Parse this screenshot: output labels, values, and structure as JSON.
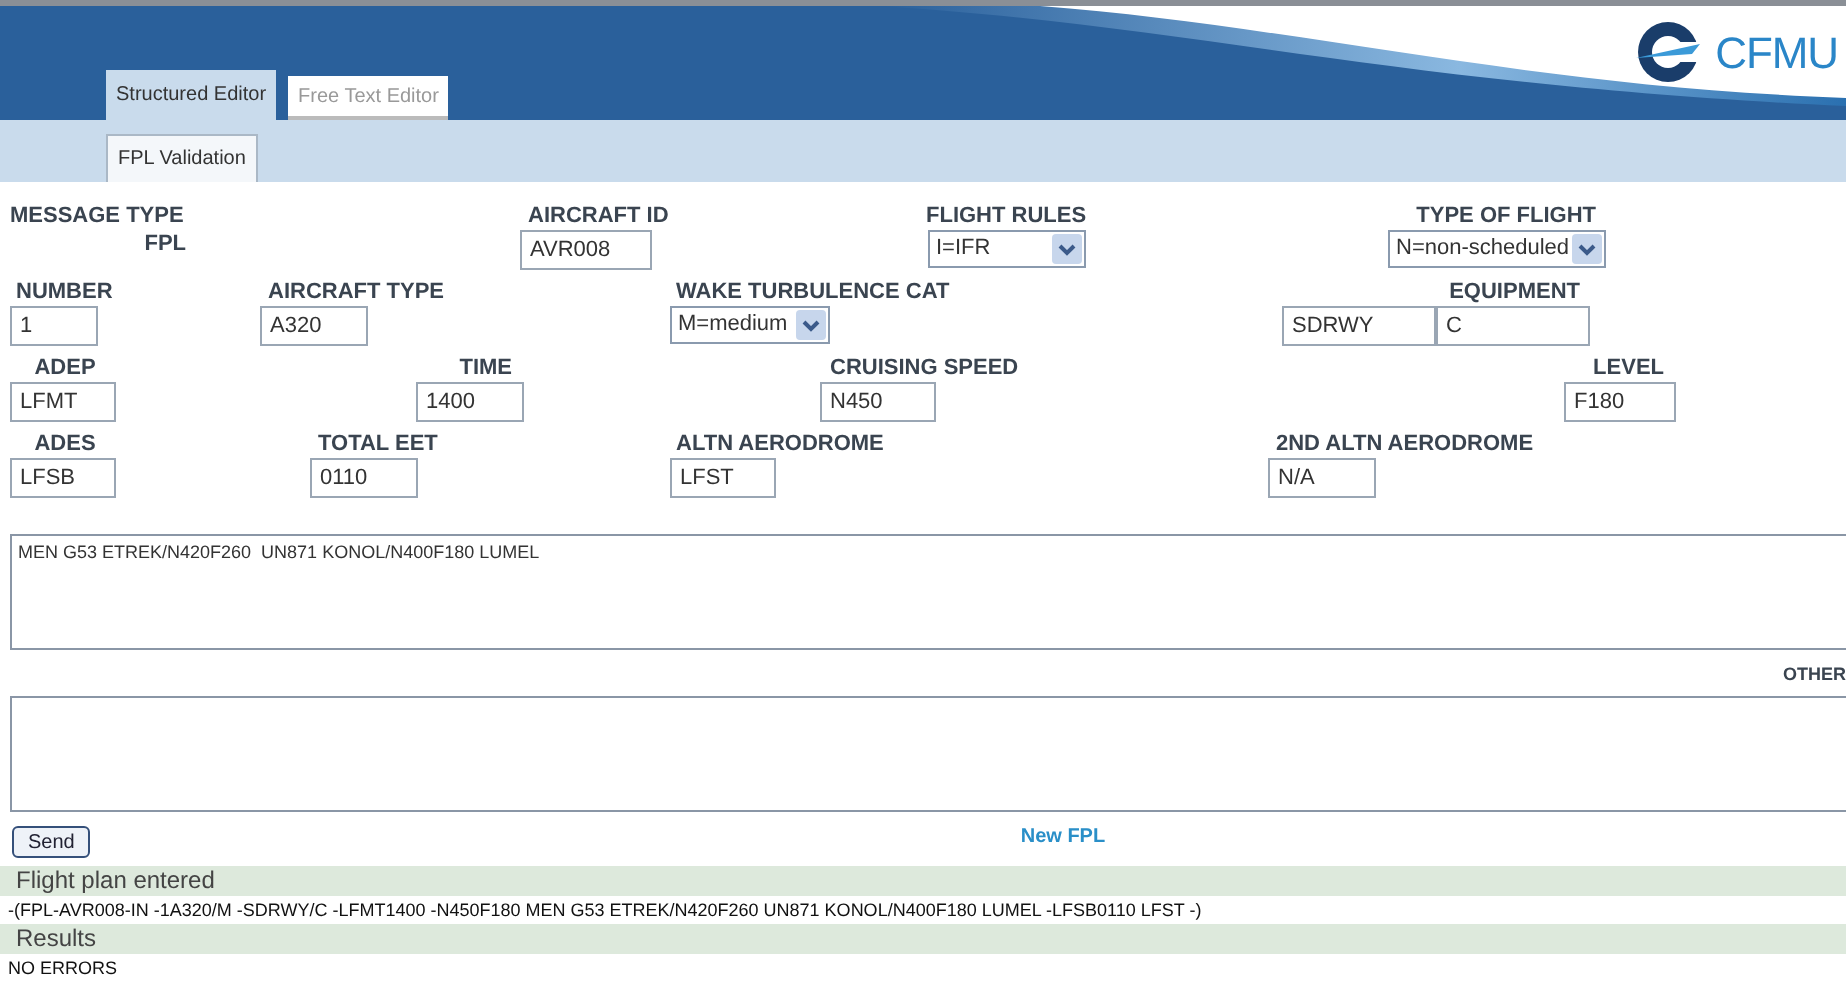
{
  "header": {
    "logo_text": "CFMU"
  },
  "tabs": [
    {
      "label": "Structured Editor",
      "selected": true
    },
    {
      "label": "Free Text Editor",
      "selected": false
    }
  ],
  "subtabs": [
    {
      "label": "FPL Validation",
      "selected": true
    }
  ],
  "form": {
    "rows": [
      [
        {
          "kind": "static",
          "label": "MESSAGE TYPE",
          "value": "FPL"
        },
        {
          "kind": "field",
          "label": "AIRCRAFT ID",
          "value": "AVR008"
        },
        {
          "kind": "select",
          "label": "FLIGHT RULES",
          "value": "I=IFR"
        },
        {
          "kind": "select",
          "label": "TYPE OF FLIGHT",
          "value": "N=non-scheduled"
        }
      ],
      [
        {
          "kind": "field",
          "label": "NUMBER",
          "value": "1"
        },
        {
          "kind": "field",
          "label": "AIRCRAFT TYPE",
          "value": "A320"
        },
        {
          "kind": "select",
          "label": "WAKE TURBULENCE CAT",
          "value": "M=medium"
        },
        {
          "kind": "double",
          "label": "EQUIPMENT",
          "values": [
            "SDRWY",
            "C"
          ]
        }
      ],
      [
        {
          "kind": "field",
          "label": "ADEP",
          "value": "LFMT"
        },
        {
          "kind": "field",
          "label": "TIME",
          "value": "1400"
        },
        {
          "kind": "field",
          "label": "CRUISING SPEED",
          "value": "N450"
        },
        {
          "kind": "field",
          "label": "LEVEL",
          "value": "F180"
        }
      ],
      [
        {
          "kind": "field",
          "label": "ADES",
          "value": "LFSB"
        },
        {
          "kind": "field",
          "label": "TOTAL EET",
          "value": "0110"
        },
        {
          "kind": "field",
          "label": "ALTN AERODROME",
          "value": "LFST"
        },
        {
          "kind": "field",
          "label": "2ND ALTN AERODROME",
          "value": "N/A"
        }
      ]
    ]
  },
  "route": {
    "value": "MEN G53 ETREK/N420F260  UN871 KONOL/N400F180 LUMEL"
  },
  "other": {
    "label": "OTHER"
  },
  "send_button": "Send",
  "new_fpl_link": "New FPL",
  "sections": [
    {
      "title": "Flight plan entered",
      "text": "-(FPL-AVR008-IN -1A320/M -SDRWY/C -LFMT1400 -N450F180  MEN G53 ETREK/N420F260  UN871 KONOL/N400F180 LUMEL -LFSB0110 LFST -)"
    },
    {
      "title": "Results",
      "text": "NO ERRORS"
    }
  ]
}
